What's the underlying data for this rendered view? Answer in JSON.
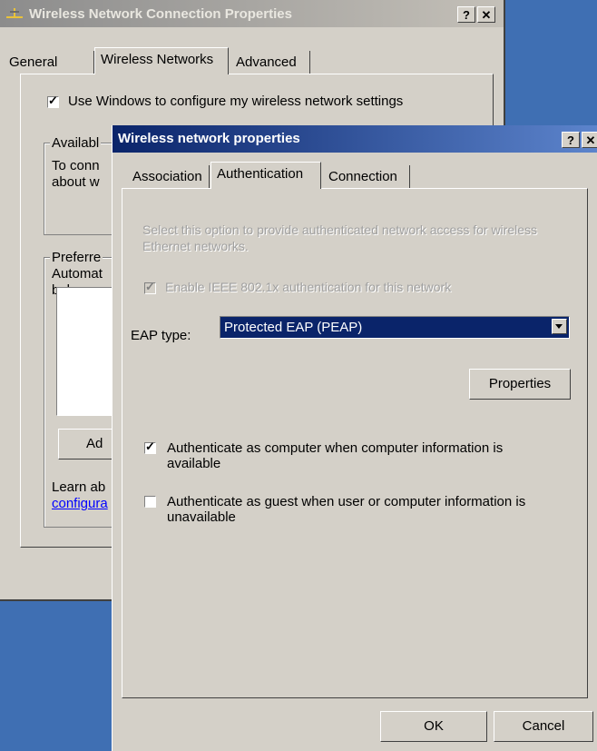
{
  "back_window": {
    "title": "Wireless Network Connection Properties",
    "help_btn": "?",
    "close_btn": "✕",
    "tabs": [
      "General",
      "Wireless Networks",
      "Advanced"
    ],
    "use_windows_label": "Use Windows to configure my wireless network settings",
    "available_group": "Availabl",
    "available_text_1": "To conn",
    "available_text_2": "about w",
    "preferred_group": "Preferre",
    "preferred_text_1": "Automat",
    "preferred_text_2": "below:",
    "add_button": "Ad",
    "learn_text": "Learn ab",
    "learn_link": "configura"
  },
  "front_window": {
    "title": "Wireless network properties",
    "help_btn": "?",
    "close_btn": "✕",
    "tabs": [
      "Association",
      "Authentication",
      "Connection"
    ],
    "description": "Select this option to provide authenticated network access for wireless Ethernet networks.",
    "enable_8021x_label": "Enable IEEE 802.1x authentication for this network",
    "eap_label": "EAP type:",
    "eap_value": "Protected EAP (PEAP)",
    "properties_button": "Properties",
    "auth_computer_label_1": "Authenticate as computer when computer information is",
    "auth_computer_label_2": "available",
    "auth_guest_label_1": "Authenticate as guest when user or computer information is",
    "auth_guest_label_2": "unavailable",
    "ok_button": "OK",
    "cancel_button": "Cancel",
    "check_mark": "✓"
  }
}
